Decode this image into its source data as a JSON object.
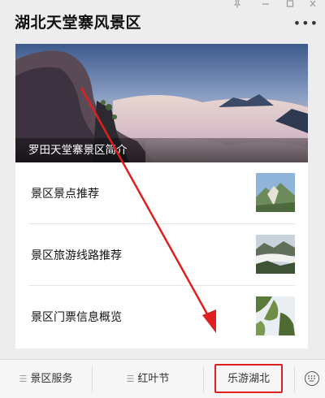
{
  "header": {
    "title": "湖北天堂寨风景区"
  },
  "hero": {
    "caption": "罗田天堂寨景区简介"
  },
  "list": [
    {
      "label": "景区景点推荐"
    },
    {
      "label": "景区旅游线路推荐"
    },
    {
      "label": "景区门票信息概览"
    }
  ],
  "menu": {
    "items": [
      {
        "label": "景区服务"
      },
      {
        "label": "红叶节"
      },
      {
        "label": "乐游湖北"
      }
    ]
  },
  "colors": {
    "annotation_red": "#e02020",
    "background": "#ededed"
  }
}
